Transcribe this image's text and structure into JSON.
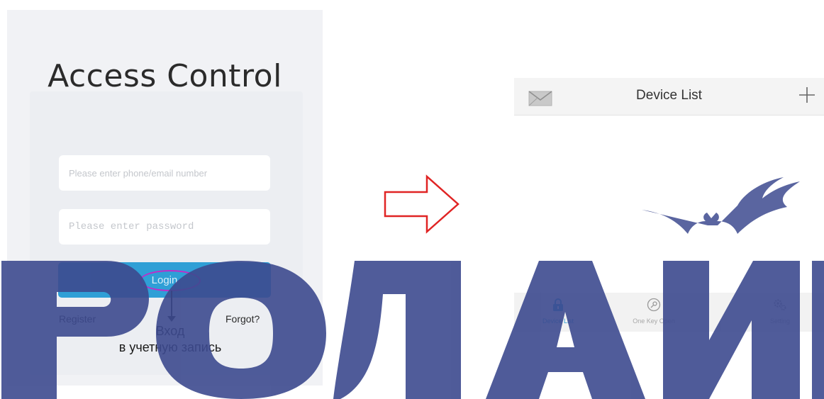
{
  "login": {
    "title": "Access Control",
    "phone_placeholder": "Please enter phone/email number",
    "password_placeholder": "Please enter password",
    "login_label": "Login",
    "register_label": "Register",
    "forgot_label": "Forgot?"
  },
  "annotation": {
    "line1": "Вход",
    "line2": "в учетную запись"
  },
  "device_list": {
    "header_title": "Device List",
    "header_left_icon": "mail-icon",
    "header_right_icon": "plus-icon",
    "tabs": [
      {
        "label": "Device List",
        "icon": "lock-icon",
        "active": true
      },
      {
        "label": "One Key Open",
        "icon": "key-icon",
        "active": false
      },
      {
        "label": "Setting",
        "icon": "gear-icon",
        "active": false
      }
    ]
  },
  "colors": {
    "accent": "#2f9fd6",
    "highlight_ring": "#c02cc8",
    "transition_arrow": "#e02424",
    "watermark": "#3d4a8f"
  },
  "watermark_text": "РОЛАЙН"
}
